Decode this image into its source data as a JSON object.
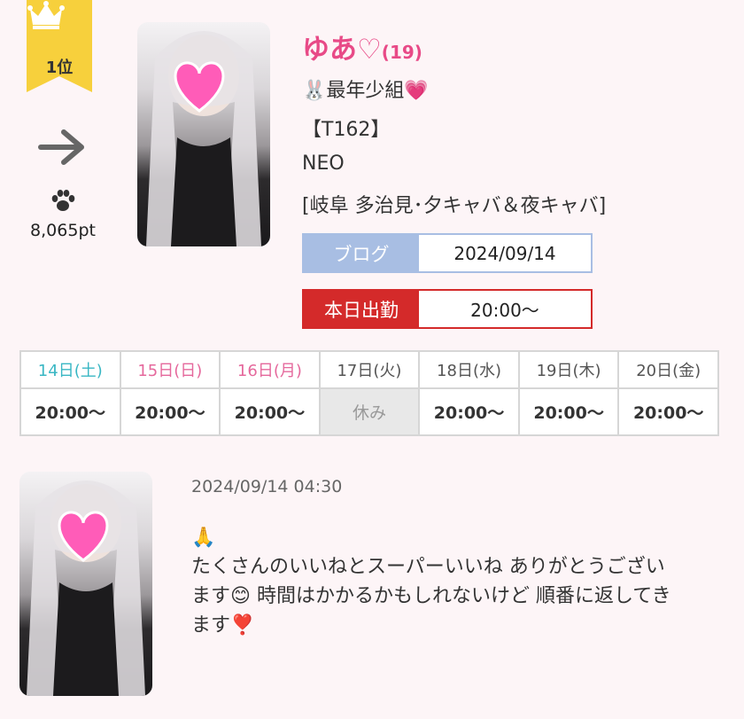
{
  "rank": {
    "label": "1位",
    "points": "8,065pt",
    "ribbon_color": "#f7d03c"
  },
  "profile": {
    "name": "ゆあ♡",
    "age": "(19)",
    "group": "🐰最年少組💗",
    "height": "【T162】",
    "shop": "NEO",
    "area": "[岐阜 多治見･夕キャバ＆夜キャバ]"
  },
  "blog_info": {
    "label": "ブログ",
    "date": "2024/09/14"
  },
  "today_shift": {
    "label": "本日出勤",
    "time": "20:00〜"
  },
  "schedule": [
    {
      "day": "14日(土)",
      "time": "20:00〜",
      "color": "#3ab7c4"
    },
    {
      "day": "15日(日)",
      "time": "20:00〜",
      "color": "#e5689c"
    },
    {
      "day": "16日(月)",
      "time": "20:00〜",
      "color": "#e5689c"
    },
    {
      "day": "17日(火)",
      "time": "休み",
      "color": "#555555"
    },
    {
      "day": "18日(水)",
      "time": "20:00〜",
      "color": "#555555"
    },
    {
      "day": "19日(木)",
      "time": "20:00〜",
      "color": "#555555"
    },
    {
      "day": "20日(金)",
      "time": "20:00〜",
      "color": "#555555"
    }
  ],
  "blog_post": {
    "datetime": "2024/09/14 04:30",
    "emoji_top": "🙏",
    "text_1": "たくさんのいいねとスーパーいいね ありがとうござい",
    "text_2a": "ます",
    "emoji_mid": "😊",
    "text_2b": " 時間はかかるかもしれないけど 順番に返してき",
    "text_3": "ます",
    "emoji_end": "❣️"
  },
  "icons": {
    "crown": "crown-icon",
    "arrow": "arrow-right-icon",
    "paw": "paw-icon",
    "heart": "heart-icon"
  }
}
